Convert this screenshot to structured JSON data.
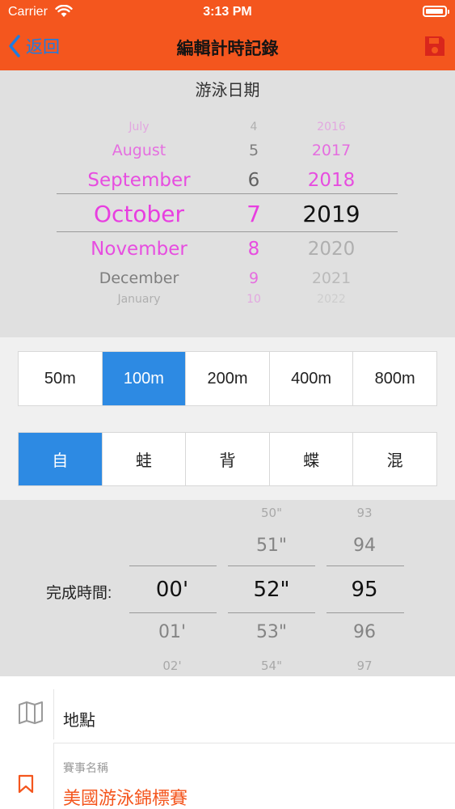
{
  "status_bar": {
    "carrier": "Carrier",
    "time": "3:13 PM"
  },
  "nav": {
    "back_label": "返回",
    "title": "編輯計時記錄"
  },
  "date_picker": {
    "label": "游泳日期",
    "months": [
      "July",
      "August",
      "September",
      "October",
      "November",
      "December",
      "January"
    ],
    "days": [
      "4",
      "5",
      "6",
      "7",
      "8",
      "9",
      "10"
    ],
    "years": [
      "2016",
      "2017",
      "2018",
      "2019",
      "2020",
      "2021",
      "2022"
    ],
    "selected": {
      "month": "October",
      "day": "7",
      "year": "2019"
    }
  },
  "distance_segment": {
    "options": [
      "50m",
      "100m",
      "200m",
      "400m",
      "800m"
    ],
    "selected": "100m"
  },
  "stroke_segment": {
    "options": [
      "自",
      "蛙",
      "背",
      "蝶",
      "混"
    ],
    "selected": "自"
  },
  "time_picker": {
    "label": "完成時間:",
    "minutes": [
      "00'",
      "01'",
      "02'"
    ],
    "seconds": [
      "50\"",
      "51\"",
      "52\"",
      "53\"",
      "54\""
    ],
    "hundredths": [
      "93",
      "94",
      "95",
      "96",
      "97"
    ]
  },
  "location_row": {
    "label": "地點"
  },
  "event_row": {
    "small_label": "賽事名稱",
    "value": "美國游泳錦標賽"
  },
  "colors": {
    "header": "#f4561e",
    "accent_blue": "#2d8ae3",
    "back_link": "#1f7ce0",
    "picker_magenta": "#e83ee0",
    "save_red": "#d9261c"
  }
}
